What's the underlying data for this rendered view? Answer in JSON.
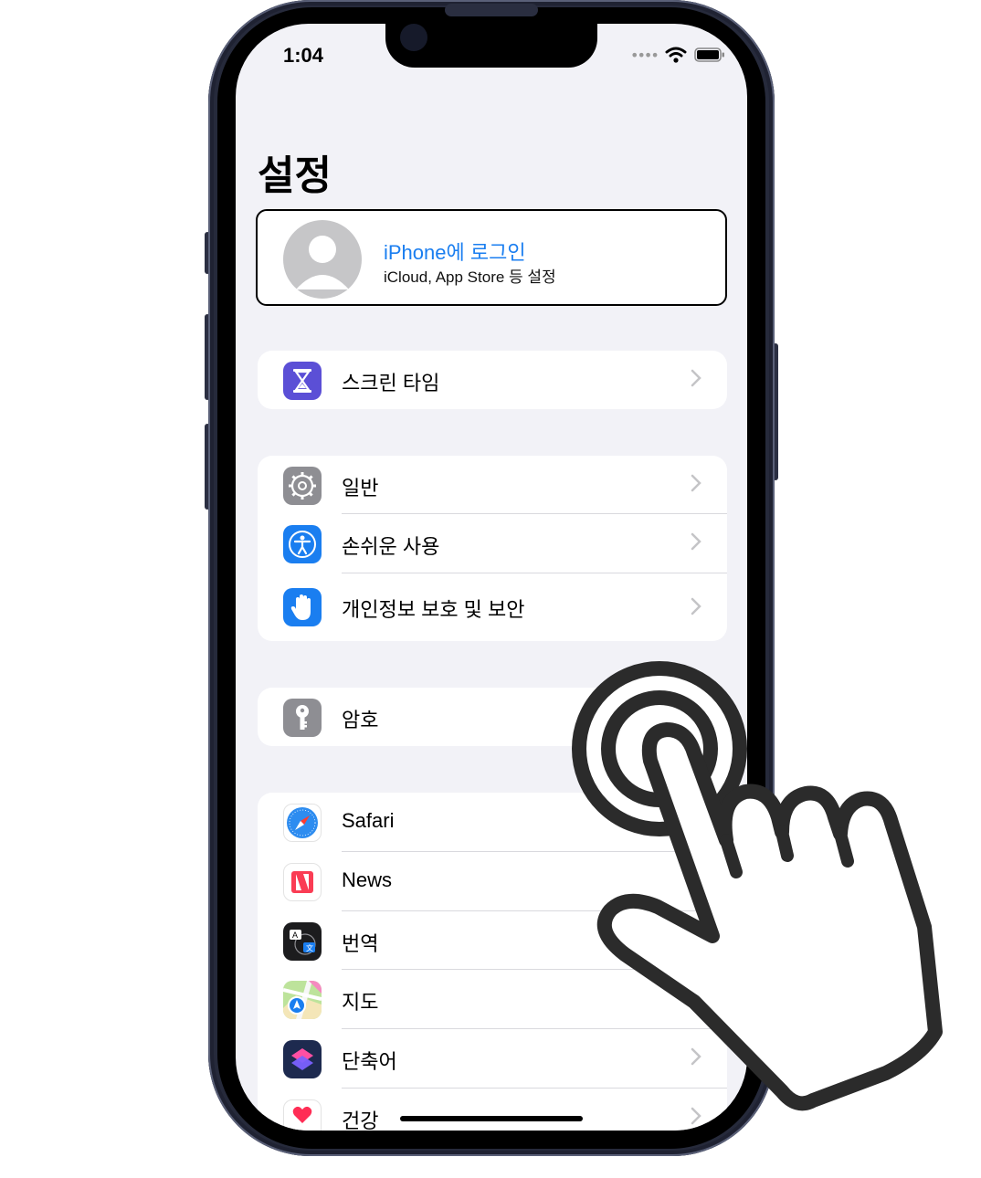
{
  "status_bar": {
    "time": "1:04"
  },
  "page_title": "설정",
  "profile": {
    "title": "iPhone에 로그인",
    "subtitle": "iCloud, App Store 등 설정"
  },
  "groups": [
    {
      "items": [
        {
          "label": "스크린 타임",
          "icon": "hourglass-icon"
        }
      ]
    },
    {
      "items": [
        {
          "label": "일반",
          "icon": "gear-icon"
        },
        {
          "label": "손쉬운 사용",
          "icon": "accessibility-icon"
        },
        {
          "label": "개인정보 보호 및 보안",
          "icon": "hand-icon"
        }
      ]
    },
    {
      "items": [
        {
          "label": "암호",
          "icon": "key-icon"
        }
      ]
    },
    {
      "items": [
        {
          "label": "Safari",
          "icon": "safari-compass-icon"
        },
        {
          "label": "News",
          "icon": "news-icon"
        },
        {
          "label": "번역",
          "icon": "translate-icon"
        },
        {
          "label": "지도",
          "icon": "maps-icon"
        },
        {
          "label": "단축어",
          "icon": "shortcuts-icon"
        },
        {
          "label": "건강",
          "icon": "health-heart-icon"
        }
      ]
    }
  ],
  "colors": {
    "screen_time": "#5b4fd6",
    "general": "#8e8e93",
    "accessibility": "#1a7ef0",
    "privacy": "#1a7ef0",
    "passwords": "#8e8e93",
    "link_blue": "#1a7ef0",
    "background": "#f2f2f7"
  }
}
